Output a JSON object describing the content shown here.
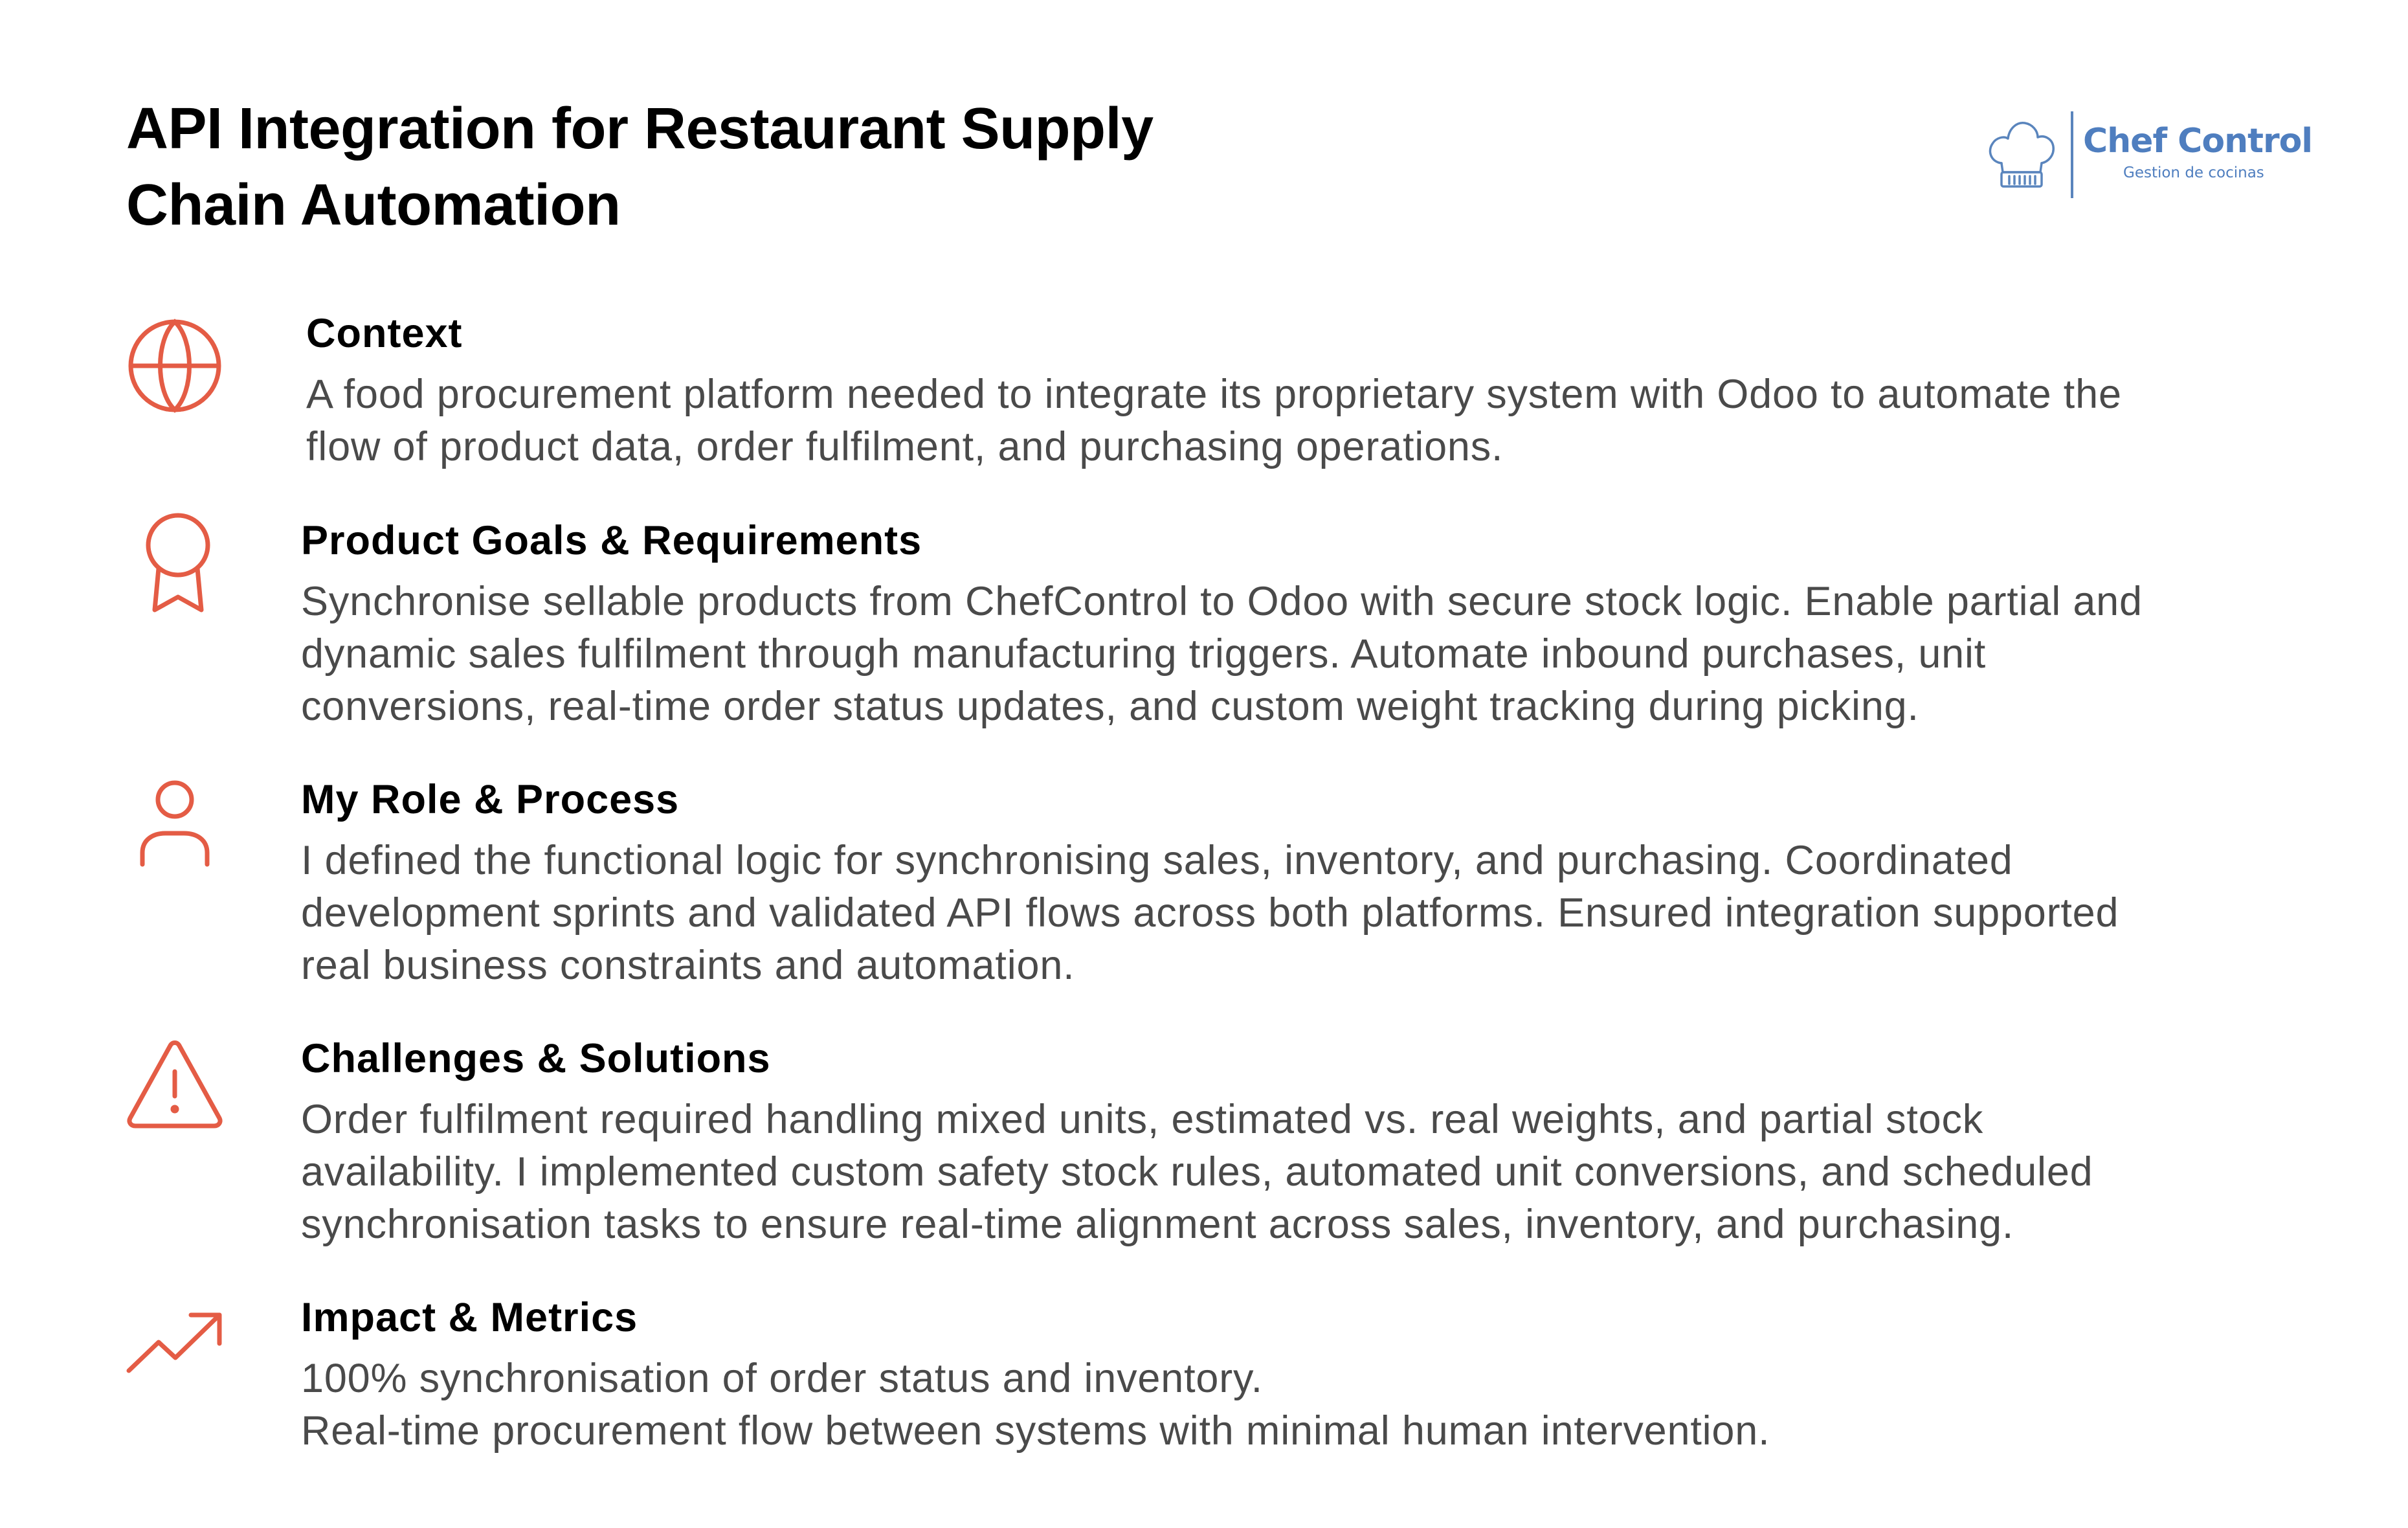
{
  "title": {
    "line1": "API Integration for Restaurant Supply",
    "line2": "Chain Automation"
  },
  "logo": {
    "brand": "Chef Control",
    "tagline": "Gestion de cocinas",
    "icon": "chef-hat-icon",
    "color": "#4f7ebf"
  },
  "accent_color": "#e45c45",
  "sections": [
    {
      "icon": "globe-icon",
      "heading": "Context",
      "lines": [
        "A food procurement platform needed to integrate its proprietary system with Odoo to automate the",
        "flow of product data, order fulfilment, and purchasing operations."
      ]
    },
    {
      "icon": "award-ribbon-icon",
      "heading": "Product Goals & Requirements",
      "lines": [
        "Synchronise sellable products from ChefControl to Odoo with secure stock logic. Enable partial and",
        "dynamic sales fulfilment through manufacturing triggers. Automate inbound purchases, unit",
        "conversions, real-time order status updates, and custom weight tracking during picking."
      ]
    },
    {
      "icon": "user-icon",
      "heading": "My Role & Process",
      "lines": [
        "I defined the functional logic for synchronising sales, inventory, and purchasing. Coordinated",
        "development sprints and validated API flows across both platforms. Ensured integration supported",
        "real business constraints and automation."
      ]
    },
    {
      "icon": "warning-triangle-icon",
      "heading": "Challenges & Solutions",
      "lines": [
        "Order fulfilment required handling mixed units, estimated vs. real weights, and partial stock",
        "availability. I implemented custom safety stock rules, automated unit conversions, and scheduled",
        "synchronisation tasks to ensure real-time alignment across sales, inventory, and purchasing."
      ]
    },
    {
      "icon": "trending-up-icon",
      "heading": "Impact & Metrics",
      "lines": [
        "100% synchronisation of order status and inventory.",
        "Real-time procurement flow between systems with minimal human intervention."
      ]
    }
  ]
}
